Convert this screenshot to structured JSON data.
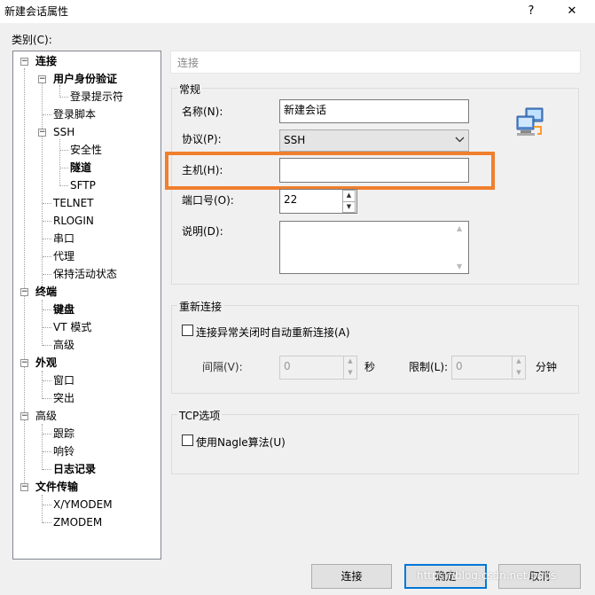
{
  "window": {
    "title": "新建会话属性",
    "help_glyph": "?",
    "close_glyph": "✕"
  },
  "category_label": "类别(C):",
  "tree": [
    {
      "label": "连接",
      "bold": true,
      "expander": "−"
    },
    {
      "label": "用户身份验证",
      "bold": true,
      "expander": "−"
    },
    {
      "label": "登录提示符",
      "bold": false
    },
    {
      "label": "登录脚本",
      "bold": false
    },
    {
      "label": "SSH",
      "bold": false,
      "expander": "−"
    },
    {
      "label": "安全性",
      "bold": false
    },
    {
      "label": "隧道",
      "bold": true
    },
    {
      "label": "SFTP",
      "bold": false
    },
    {
      "label": "TELNET",
      "bold": false
    },
    {
      "label": "RLOGIN",
      "bold": false
    },
    {
      "label": "串口",
      "bold": false
    },
    {
      "label": "代理",
      "bold": false
    },
    {
      "label": "保持活动状态",
      "bold": false
    },
    {
      "label": "终端",
      "bold": true,
      "expander": "−"
    },
    {
      "label": "键盘",
      "bold": true
    },
    {
      "label": "VT 模式",
      "bold": false
    },
    {
      "label": "高级",
      "bold": false
    },
    {
      "label": "外观",
      "bold": true,
      "expander": "−"
    },
    {
      "label": "窗口",
      "bold": false
    },
    {
      "label": "突出",
      "bold": false
    },
    {
      "label": "高级",
      "bold": false,
      "expander": "−"
    },
    {
      "label": "跟踪",
      "bold": false
    },
    {
      "label": "响铃",
      "bold": false
    },
    {
      "label": "日志记录",
      "bold": true
    },
    {
      "label": "文件传输",
      "bold": true,
      "expander": "−"
    },
    {
      "label": "X/YMODEM",
      "bold": false
    },
    {
      "label": "ZMODEM",
      "bold": false
    }
  ],
  "panel_header": "连接",
  "general": {
    "group_label": "常规",
    "name_label": "名称(N):",
    "name_value": "新建会话",
    "protocol_label": "协议(P):",
    "protocol_value": "SSH",
    "host_label": "主机(H):",
    "host_value": "",
    "port_label": "端口号(O):",
    "port_value": "22",
    "desc_label": "说明(D):",
    "desc_value": ""
  },
  "reconnect": {
    "group_label": "重新连接",
    "checkbox_label": "连接异常关闭时自动重新连接(A)",
    "interval_label": "间隔(V):",
    "interval_value": "0",
    "interval_unit": "秒",
    "limit_label": "限制(L):",
    "limit_value": "0",
    "limit_unit": "分钟"
  },
  "tcp": {
    "group_label": "TCP选项",
    "nagle_label": "使用Nagle算法(U)"
  },
  "buttons": {
    "connect": "连接",
    "ok": "确定",
    "cancel": "取消"
  },
  "watermark": "https://blog.csdn.net/pops",
  "highlight_color": "#f07f2e",
  "accent_color": "#0078d7",
  "icons": {
    "network": "network-computers-icon",
    "dropdown": "chevron-down-icon"
  }
}
